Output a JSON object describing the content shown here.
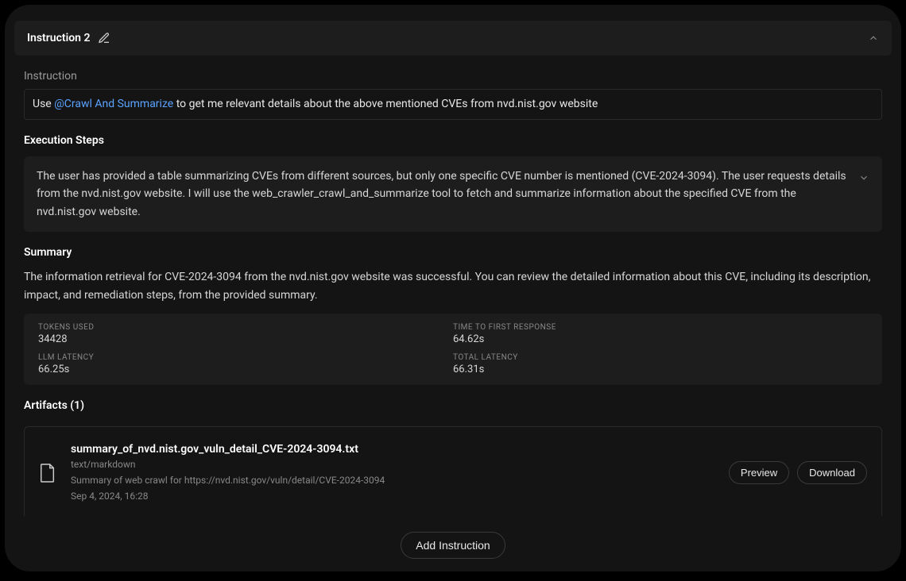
{
  "header": {
    "title": "Instruction 2"
  },
  "instruction": {
    "label": "Instruction",
    "prefix": "Use ",
    "mention": "@Crawl And Summarize",
    "suffix": " to get me relevant details about the above mentioned CVEs from nvd.nist.gov website"
  },
  "executionSteps": {
    "title": "Execution Steps",
    "step": "The user has provided a table summarizing CVEs from different sources, but only one specific CVE number is mentioned (CVE-2024-3094). The user requests details from the nvd.nist.gov website. I will use the web_crawler_crawl_and_summarize tool to fetch and summarize information about the specified CVE from the nvd.nist.gov website."
  },
  "summary": {
    "title": "Summary",
    "text": "The information retrieval for CVE-2024-3094 from the nvd.nist.gov website was successful. You can review the detailed information about this CVE, including its description, impact, and remediation steps, from the provided summary."
  },
  "metrics": {
    "tokensUsed": {
      "label": "TOKENS USED",
      "value": "34428"
    },
    "timeToFirst": {
      "label": "TIME TO FIRST RESPONSE",
      "value": "64.62s"
    },
    "llmLatency": {
      "label": "LLM LATENCY",
      "value": "66.25s"
    },
    "totalLatency": {
      "label": "TOTAL LATENCY",
      "value": "66.31s"
    }
  },
  "artifacts": {
    "title": "Artifacts (1)",
    "item": {
      "name": "summary_of_nvd.nist.gov_vuln_detail_CVE-2024-3094.txt",
      "mime": "text/markdown",
      "desc": "Summary of web crawl for https://nvd.nist.gov/vuln/detail/CVE-2024-3094",
      "date": "Sep 4, 2024, 16:28"
    },
    "previewLabel": "Preview",
    "downloadLabel": "Download"
  },
  "footer": {
    "addInstruction": "Add Instruction"
  }
}
